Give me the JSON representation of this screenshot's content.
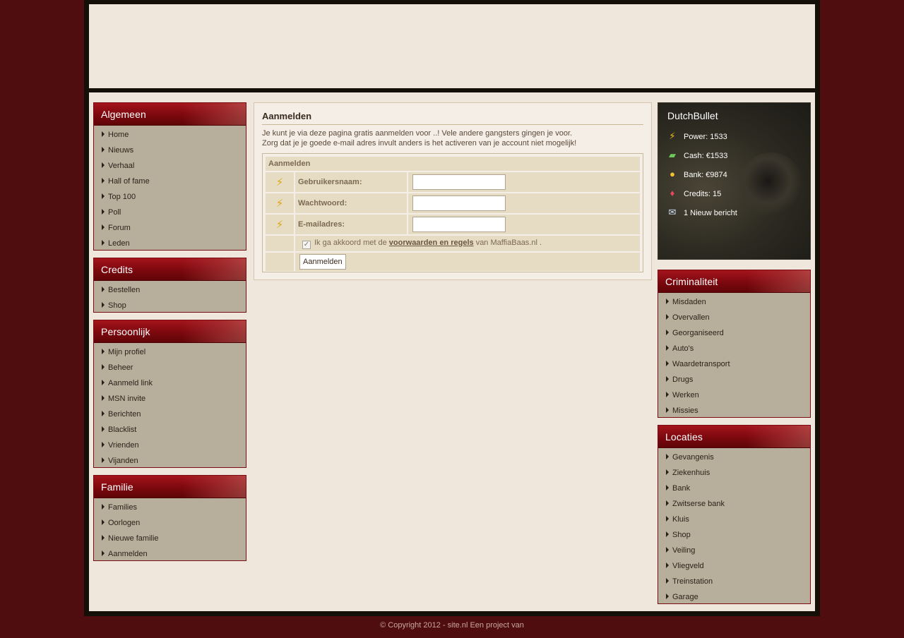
{
  "left_menus": [
    {
      "title": "Algemeen",
      "items": [
        "Home",
        "Nieuws",
        "Verhaal",
        "Hall of fame",
        "Top 100",
        "Poll",
        "Forum",
        "Leden"
      ]
    },
    {
      "title": "Credits",
      "items": [
        "Bestellen",
        "Shop"
      ]
    },
    {
      "title": "Persoonlijk",
      "items": [
        "Mijn profiel",
        "Beheer",
        "Aanmeld link",
        "MSN invite",
        "Berichten",
        "Blacklist",
        "Vrienden",
        "Vijanden"
      ]
    },
    {
      "title": "Familie",
      "items": [
        "Families",
        "Oorlogen",
        "Nieuwe familie",
        "Aanmelden"
      ]
    }
  ],
  "right_menus": [
    {
      "title": "Criminaliteit",
      "items": [
        "Misdaden",
        "Overvallen",
        "Georganiseerd",
        "Auto's",
        "Waardetransport",
        "Drugs",
        "Werken",
        "Missies"
      ]
    },
    {
      "title": "Locaties",
      "items": [
        "Gevangenis",
        "Ziekenhuis",
        "Bank",
        "Zwitserse bank",
        "Kluis",
        "Shop",
        "Veiling",
        "Vliegveld",
        "Treinstation",
        "Garage"
      ]
    }
  ],
  "main": {
    "title": "Aanmelden",
    "intro_line1": "Je kunt je via deze pagina gratis aanmelden voor ..! Vele andere gangsters gingen je voor.",
    "intro_line2": "Zorg dat je je goede e-mail adres invult anders is het activeren van je account niet mogelijk!",
    "form": {
      "header": "Aanmelden",
      "username_label": "Gebruikersnaam:",
      "password_label": "Wachtwoord:",
      "email_label": "E-mailadres:",
      "username_value": "",
      "password_value": "",
      "email_value": "",
      "agree_prefix": "Ik ga akkoord met de",
      "agree_link": "voorwaarden en regels",
      "agree_suffix": "van MaffiaBaas.nl .",
      "agree_checked": true,
      "submit_label": "Aanmelden"
    }
  },
  "user": {
    "name": "DutchBullet",
    "power": "Power: 1533",
    "cash": "Cash: €1533",
    "bank": "Bank: €9874",
    "credits": "Credits: 15",
    "messages": "1 Nieuw bericht"
  },
  "footer": {
    "text": "© Copyright 2012 - site.nl Een project van"
  },
  "colors": {
    "page_background": "#4f0d10",
    "content_background": "#f0e7dc",
    "menu_header": "#8c0c12",
    "menu_body": "#b8ae9c",
    "form_cell": "#e5dcc3"
  },
  "icons": {
    "row_icon": "lightning-icon",
    "power": "lightning-icon",
    "cash": "banknote-icon",
    "bank": "coins-icon",
    "credits": "gem-icon",
    "messages": "envelope-icon"
  }
}
